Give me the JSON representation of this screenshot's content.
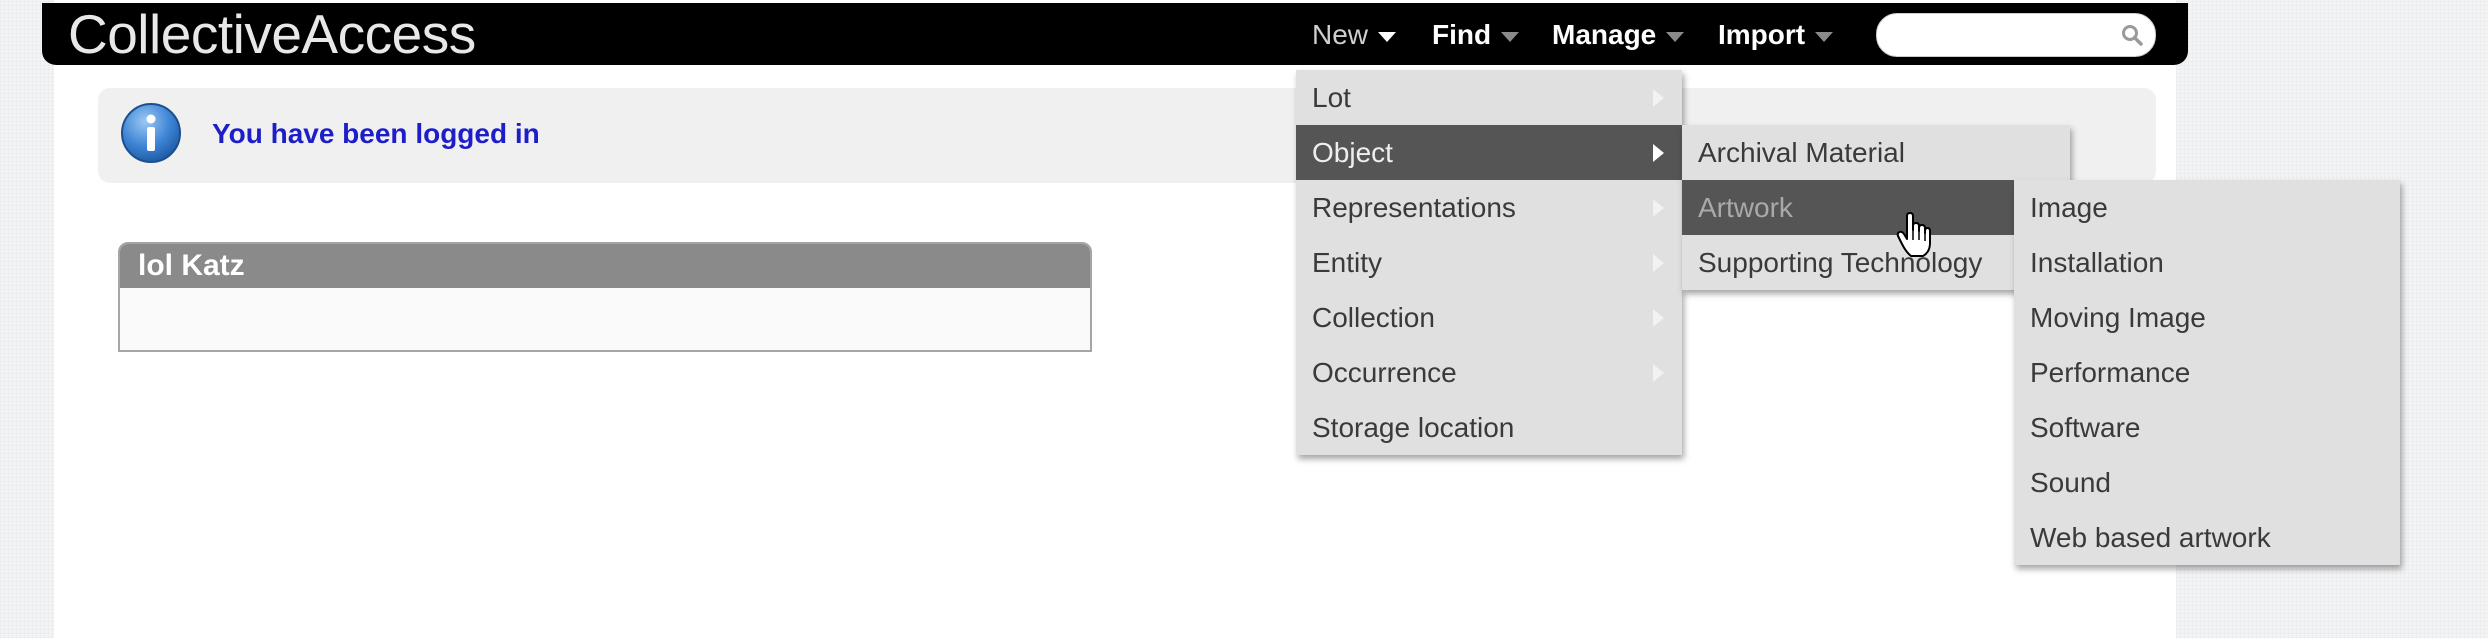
{
  "app": {
    "logo_text": "CollectiveAccess"
  },
  "nav": {
    "items": [
      {
        "label": "New"
      },
      {
        "label": "Find"
      },
      {
        "label": "Manage"
      },
      {
        "label": "Import"
      }
    ],
    "search": {
      "placeholder": "",
      "value": ""
    }
  },
  "notice": {
    "text": "You have been logged in",
    "icon": "info-icon"
  },
  "user_box": {
    "title": "lol Katz"
  },
  "menus": {
    "new": {
      "items": [
        {
          "label": "Lot",
          "has_submenu": true
        },
        {
          "label": "Object",
          "has_submenu": true,
          "state": "active"
        },
        {
          "label": "Representations",
          "has_submenu": true
        },
        {
          "label": "Entity",
          "has_submenu": true
        },
        {
          "label": "Collection",
          "has_submenu": true
        },
        {
          "label": "Occurrence",
          "has_submenu": true
        },
        {
          "label": "Storage location",
          "has_submenu": false
        }
      ]
    },
    "object": {
      "items": [
        {
          "label": "Archival Material"
        },
        {
          "label": "Artwork",
          "state": "hovered"
        },
        {
          "label": "Supporting Technology"
        }
      ]
    },
    "artwork": {
      "items": [
        {
          "label": "Image"
        },
        {
          "label": "Installation"
        },
        {
          "label": "Moving Image"
        },
        {
          "label": "Performance"
        },
        {
          "label": "Software"
        },
        {
          "label": "Sound"
        },
        {
          "label": "Web based artwork"
        }
      ]
    }
  },
  "colors": {
    "navbar": "#000000",
    "menu_bg": "#e0e0e0",
    "menu_active": "#555555",
    "notice_text": "#1e1ec8",
    "box_header": "#8a8a8a"
  }
}
